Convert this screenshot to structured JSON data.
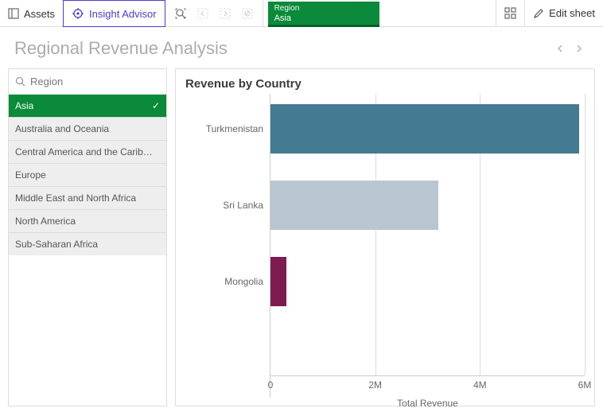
{
  "toolbar": {
    "assets_label": "Assets",
    "insight_label": "Insight Advisor",
    "filter": {
      "field": "Region",
      "value": "Asia"
    },
    "edit_label": "Edit sheet"
  },
  "page": {
    "title": "Regional Revenue Analysis"
  },
  "filter_panel": {
    "search_label": "Region",
    "items": [
      {
        "label": "Asia",
        "selected": true
      },
      {
        "label": "Australia and Oceania",
        "selected": false
      },
      {
        "label": "Central America and the Carib…",
        "selected": false
      },
      {
        "label": "Europe",
        "selected": false
      },
      {
        "label": "Middle East and North Africa",
        "selected": false
      },
      {
        "label": "North America",
        "selected": false
      },
      {
        "label": "Sub-Saharan Africa",
        "selected": false
      }
    ]
  },
  "chart": {
    "title": "Revenue by Country"
  },
  "chart_data": {
    "type": "bar",
    "orientation": "horizontal",
    "title": "Revenue by Country",
    "xlabel": "Total Revenue",
    "ylabel": "",
    "xlim": [
      0,
      6000000
    ],
    "x_ticks": [
      {
        "value": 0,
        "label": "0"
      },
      {
        "value": 2000000,
        "label": "2M"
      },
      {
        "value": 4000000,
        "label": "4M"
      },
      {
        "value": 6000000,
        "label": "6M"
      }
    ],
    "categories": [
      "Turkmenistan",
      "Sri Lanka",
      "Mongolia"
    ],
    "values": [
      5900000,
      3200000,
      300000
    ],
    "colors": [
      "#447a92",
      "#b9c6d1",
      "#7e1b4f"
    ]
  }
}
